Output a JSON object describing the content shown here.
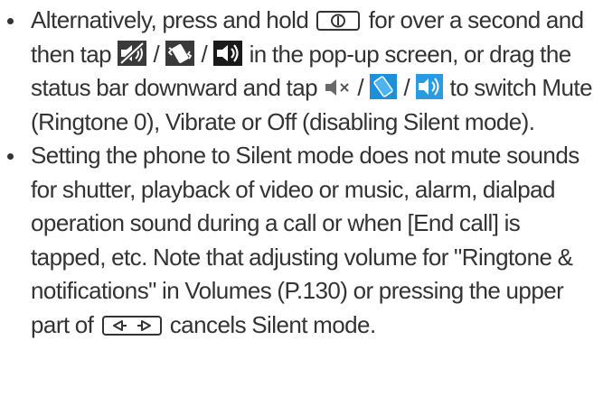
{
  "items": [
    {
      "t1": "Alternatively, press and hold",
      "t2": "for over a second and then tap",
      "sep1": "/",
      "sep2": "/",
      "t3": "in the pop-up screen, or drag the status bar downward and tap",
      "sep3": "/",
      "sep4": "/",
      "t4": "to switch Mute (Ringtone 0), Vibrate or Off (disabling Silent mode).",
      "icons": {
        "power_key": "power-key-icon",
        "mute": "mute-speaker-icon",
        "vibrate": "vibrate-icon",
        "sound_on": "sound-on-speaker-icon",
        "mute_status": "mute-status-icon",
        "vibrate_status": "vibrate-status-icon",
        "sound_status": "sound-status-icon"
      }
    },
    {
      "t1": "Setting the phone to Silent mode does not mute sounds for shutter, playback of video or music, alarm, dialpad operation sound during a call or when [End call] is tapped, etc. Note that adjusting volume for \"Ringtone & notifications\" in Volumes (P.130) or pressing the upper part of",
      "t2": "cancels Silent mode.",
      "icons": {
        "volume_key": "volume-key-icon"
      }
    }
  ],
  "colors": {
    "text": "#333333",
    "icon_dark": "#3c3c3c",
    "icon_accent": "#1e90d8",
    "icon_blue_light": "#4fb3f0"
  }
}
